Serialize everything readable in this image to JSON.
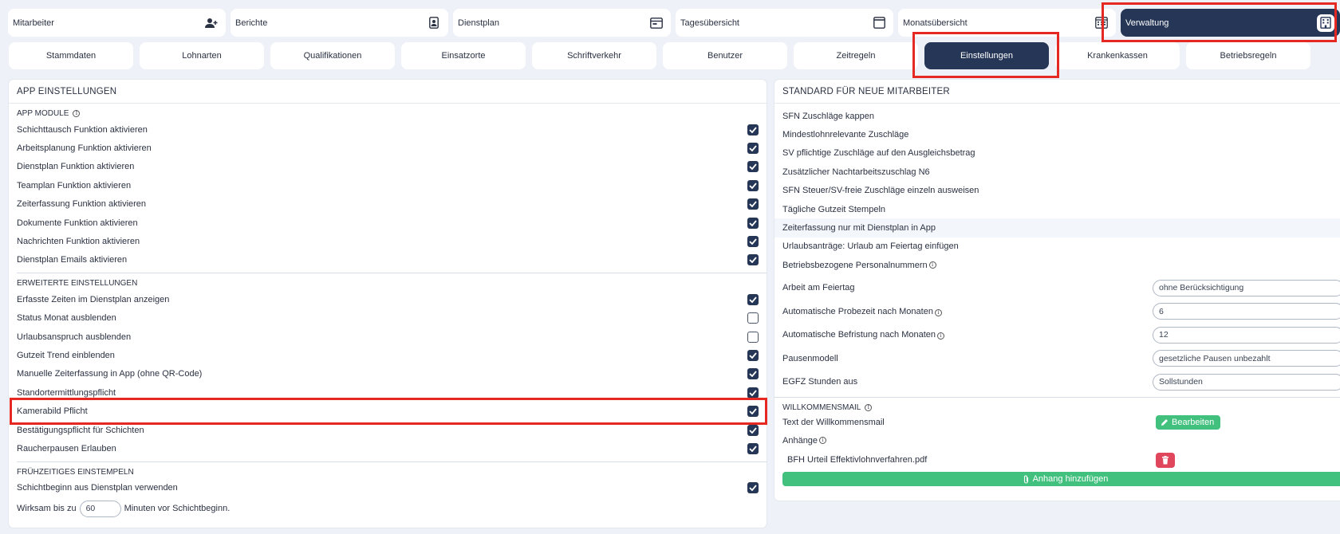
{
  "top_nav": [
    {
      "label": "Mitarbeiter",
      "icon": "user-plus-icon"
    },
    {
      "label": "Berichte",
      "icon": "report-icon"
    },
    {
      "label": "Dienstplan",
      "icon": "schedule-icon"
    },
    {
      "label": "Tagesübersicht",
      "icon": "calendar-day-icon"
    },
    {
      "label": "Monatsübersicht",
      "icon": "calendar-month-icon"
    },
    {
      "label": "Verwaltung",
      "icon": "building-icon"
    }
  ],
  "sub_nav": [
    "Stammdaten",
    "Lohnarten",
    "Qualifikationen",
    "Einsatzorte",
    "Schriftverkehr",
    "Benutzer",
    "Zeitregeln",
    "Einstellungen",
    "Krankenkassen",
    "Betriebsregeln"
  ],
  "left_panel": {
    "title": "APP EINSTELLUNGEN",
    "app_module_title": "APP MODULE",
    "app_module": [
      {
        "label": "Schichttausch Funktion aktivieren",
        "checked": true
      },
      {
        "label": "Arbeitsplanung Funktion aktivieren",
        "checked": true
      },
      {
        "label": "Dienstplan Funktion aktivieren",
        "checked": true
      },
      {
        "label": "Teamplan Funktion aktivieren",
        "checked": true
      },
      {
        "label": "Zeiterfassung Funktion aktivieren",
        "checked": true
      },
      {
        "label": "Dokumente Funktion aktivieren",
        "checked": true
      },
      {
        "label": "Nachrichten Funktion aktivieren",
        "checked": true
      },
      {
        "label": "Dienstplan Emails aktivieren",
        "checked": true
      }
    ],
    "erweitert_title": "ERWEITERTE EINSTELLUNGEN",
    "erweitert": [
      {
        "label": "Erfasste Zeiten im Dienstplan anzeigen",
        "checked": true
      },
      {
        "label": "Status Monat ausblenden",
        "checked": false
      },
      {
        "label": "Urlaubsanspruch ausblenden",
        "checked": false
      },
      {
        "label": "Gutzeit Trend einblenden",
        "checked": true
      },
      {
        "label": "Manuelle Zeiterfassung in App (ohne QR-Code)",
        "checked": true
      },
      {
        "label": "Standortermittlungspflicht",
        "checked": true
      },
      {
        "label": "Kamerabild Pflicht",
        "checked": true
      },
      {
        "label": "Bestätigungspflicht für Schichten",
        "checked": true
      },
      {
        "label": "Raucherpausen Erlauben",
        "checked": true
      }
    ],
    "frueh_title": "FRÜHZEITIGES EINSTEMPELN",
    "frueh_row": {
      "label": "Schichtbeginn aus Dienstplan verwenden",
      "checked": true
    },
    "wirksam_prefix": "Wirksam bis zu",
    "wirksam_value": "60",
    "wirksam_suffix": "Minuten vor Schichtbeginn."
  },
  "right_panel": {
    "title": "STANDARD FÜR NEUE MITARBEITER",
    "rows": [
      "SFN Zuschläge kappen",
      "Mindestlohnrelevante Zuschläge",
      "SV pflichtige Zuschläge auf den Ausgleichsbetrag",
      "Zusätzlicher Nachtarbeitszuschlag N6",
      "SFN Steuer/SV-freie Zuschläge einzeln ausweisen",
      "Tägliche Gutzeit Stempeln",
      "Zeiterfassung nur mit Dienstplan in App",
      "Urlaubsanträge: Urlaub am Feiertag einfügen",
      "Betriebsbezogene Personalnummern"
    ],
    "fields": [
      {
        "label": "Arbeit am Feiertag",
        "value": "ohne Berücksichtigung"
      },
      {
        "label": "Automatische Probezeit nach Monaten",
        "value": "6"
      },
      {
        "label": "Automatische Befristung nach Monaten",
        "value": "12"
      },
      {
        "label": "Pausenmodell",
        "value": "gesetzliche Pausen unbezahlt"
      },
      {
        "label": "EGFZ Stunden aus",
        "value": "Sollstunden"
      }
    ],
    "willkommen_title": "WILLKOMMENSMAIL",
    "text_label": "Text der Willkommensmail",
    "edit_button": "Bearbeiten",
    "anhaenge_label": "Anhänge",
    "attachment_name": "BFH Urteil Effektivlohnverfahren.pdf",
    "add_attachment_button": "Anhang hinzufügen"
  },
  "colors": {
    "primary": "#253656",
    "highlight": "#e52822",
    "success": "#42c07e",
    "danger": "#e0465c"
  }
}
